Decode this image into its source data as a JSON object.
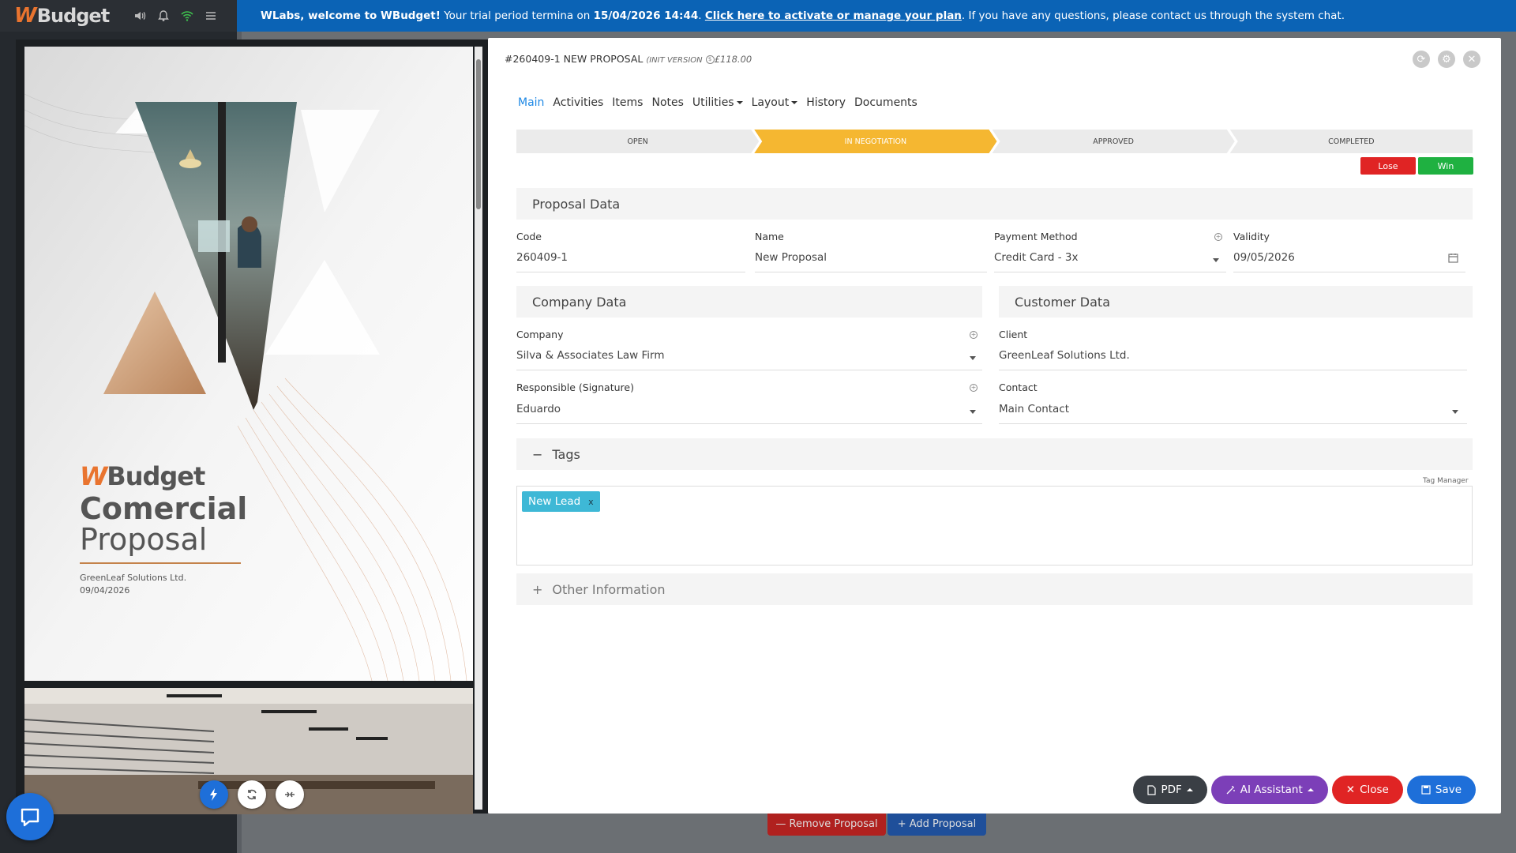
{
  "app": {
    "brand_w": "W",
    "brand_rest": "Budget"
  },
  "banner": {
    "greeting": "WLabs, welcome to WBudget!",
    "trial_text": " Your trial period termina on ",
    "trial_date": "15/04/2026 14:44",
    "sep": ". ",
    "link": "Click here to activate or manage your plan",
    "tail": ". If you have any questions, please contact us through the system chat."
  },
  "preview": {
    "cover_brand_w": "W",
    "cover_brand_rest": "Budget",
    "title_line1": "Comercial",
    "title_line2": "Proposal",
    "client": "GreenLeaf Solutions Ltd.",
    "date": "09/04/2026"
  },
  "modal": {
    "code_title": "#260409-1",
    "name_title": "NEW PROPOSAL",
    "version": "(INIT VERSION",
    "price": "£118.00"
  },
  "tabs": [
    {
      "label": "Main",
      "active": true
    },
    {
      "label": "Activities"
    },
    {
      "label": "Items"
    },
    {
      "label": "Notes"
    },
    {
      "label": "Utilities",
      "dropdown": true
    },
    {
      "label": "Layout",
      "dropdown": true
    },
    {
      "label": "History"
    },
    {
      "label": "Documents"
    }
  ],
  "pipeline": [
    "OPEN",
    "IN NEGOTIATION",
    "APPROVED",
    "COMPLETED"
  ],
  "pipeline_active": 1,
  "buttons": {
    "lose": "Lose",
    "win": "Win",
    "pdf": "PDF",
    "ai": "AI Assistant",
    "close": "Close",
    "save": "Save",
    "remove_proposal": "— Remove Proposal",
    "add_proposal": "+ Add Proposal"
  },
  "sections": {
    "proposal_data": "Proposal Data",
    "company_data": "Company Data",
    "customer_data": "Customer Data",
    "tags": "Tags",
    "tags_toggle": "−",
    "other_info": "Other Information",
    "other_toggle": "+",
    "tag_manager": "Tag Manager"
  },
  "fields": {
    "code_label": "Code",
    "code_value": "260409-1",
    "name_label": "Name",
    "name_value": "New Proposal",
    "payment_label": "Payment Method",
    "payment_value": "Credit Card - 3x",
    "validity_label": "Validity",
    "validity_value": "09/05/2026",
    "company_label": "Company",
    "company_value": "Silva & Associates Law Firm",
    "client_label": "Client",
    "client_value": "GreenLeaf Solutions Ltd.",
    "responsible_label": "Responsible (Signature)",
    "responsible_value": "Eduardo",
    "contact_label": "Contact",
    "contact_value": "Main Contact"
  },
  "tags": [
    {
      "label": "New Lead",
      "remove": "x"
    }
  ],
  "colors": {
    "accent": "#1e88e5",
    "pipeline_active": "#f5b731",
    "lose": "#e02424",
    "win": "#1fb141",
    "tag": "#3eb8d6",
    "banner": "#0b63b5"
  }
}
